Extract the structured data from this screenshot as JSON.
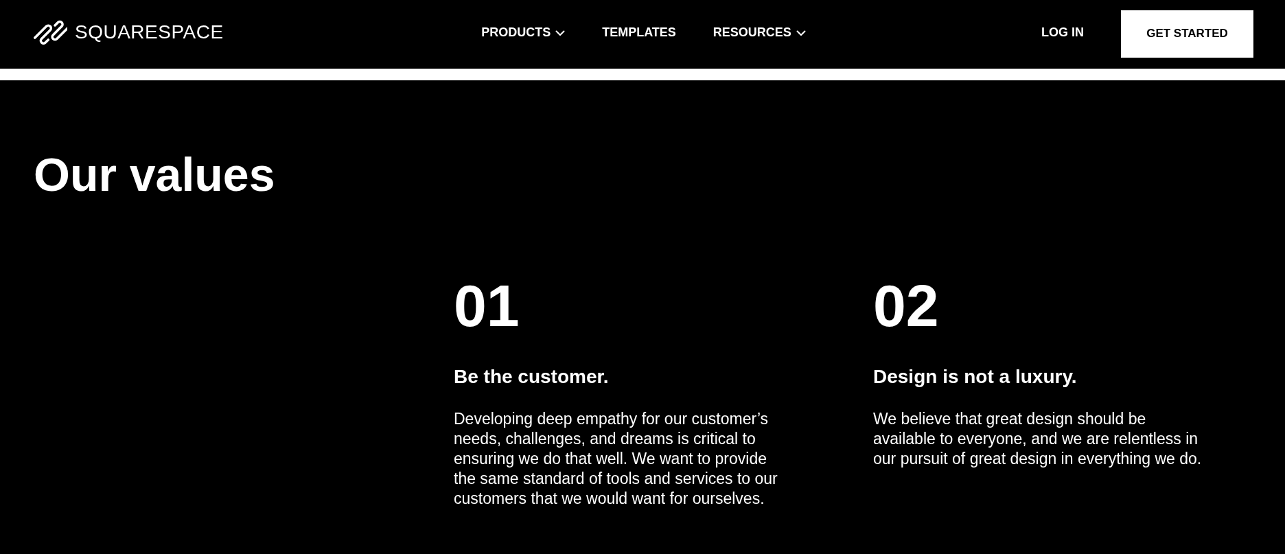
{
  "header": {
    "logo": {
      "text": "SQUARESPACE"
    },
    "nav": [
      {
        "label": "PRODUCTS",
        "kind": "dropdown"
      },
      {
        "label": "TEMPLATES",
        "kind": "link"
      },
      {
        "label": "RESOURCES",
        "kind": "dropdown"
      }
    ],
    "login": "LOG IN",
    "cta": "GET STARTED"
  },
  "values_section": {
    "title": "Our values",
    "values": [
      {
        "number": "01",
        "title": "Be the customer.",
        "description": "Developing deep empathy for our customer’s needs, challenges, and dreams is critical to ensuring we do that well. We want to provide the same standard of tools and services to our customers that we would want for ourselves."
      },
      {
        "number": "02",
        "title": "Design is not a luxury.",
        "description": "We believe that great design should be available to everyone, and we are relentless in our pursuit of great design in everything we do."
      }
    ]
  }
}
